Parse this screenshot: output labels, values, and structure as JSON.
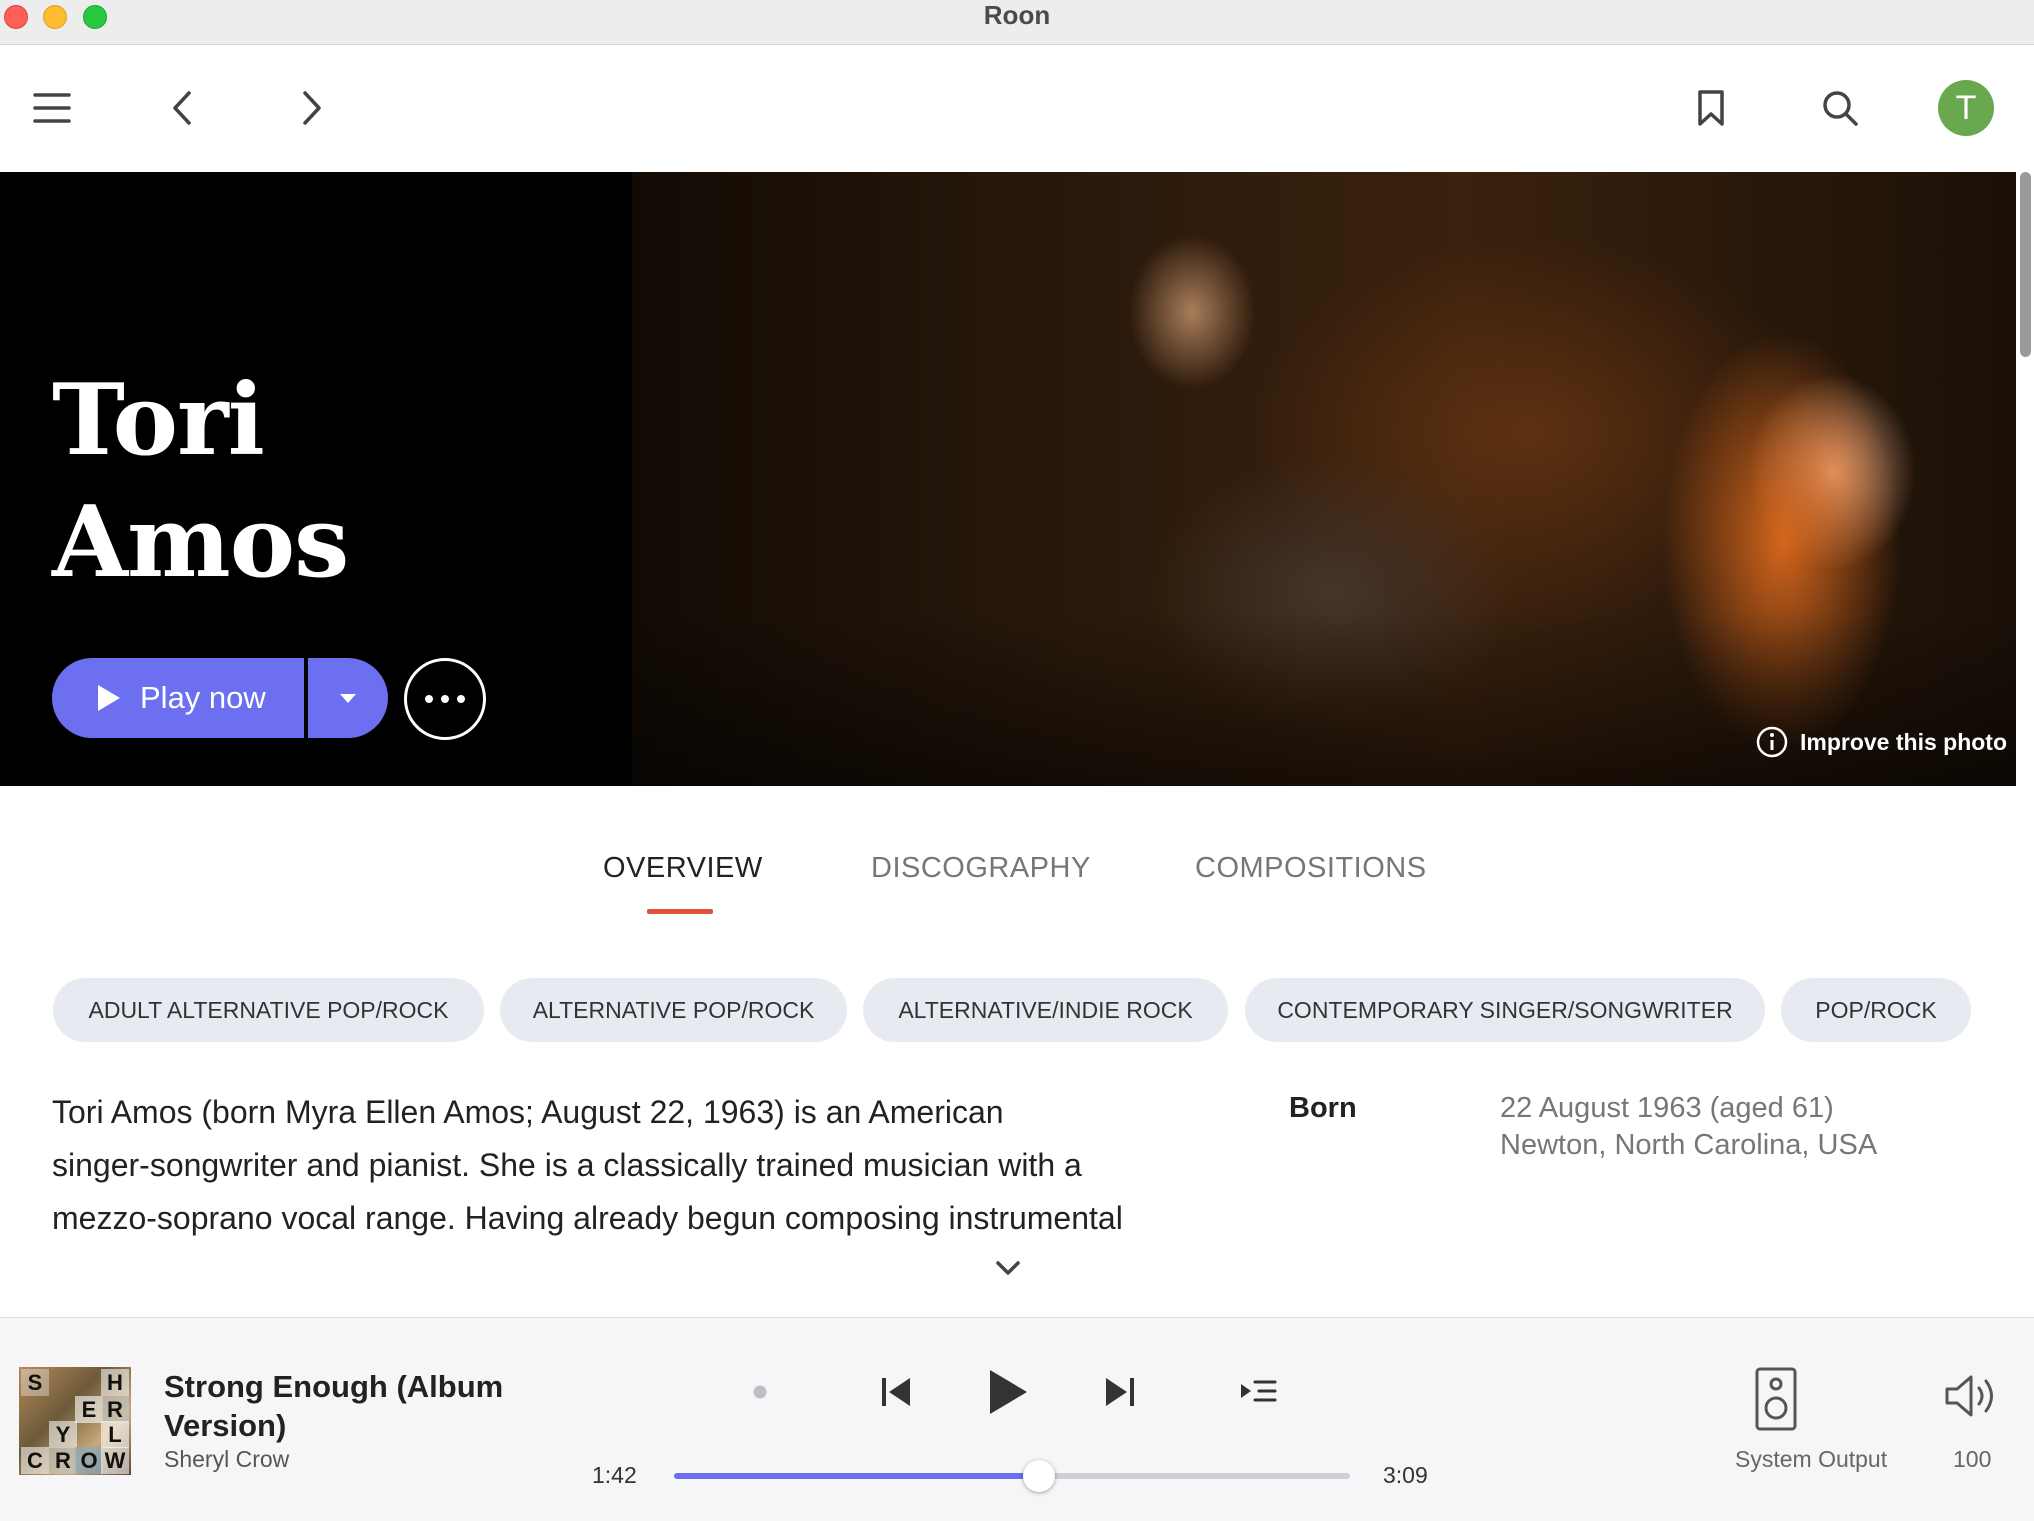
{
  "window": {
    "title": "Roon"
  },
  "toolbar": {
    "menu_icon": "hamburger-icon",
    "back_icon": "chevron-left-icon",
    "forward_icon": "chevron-right-icon",
    "bookmark_icon": "bookmark-icon",
    "search_icon": "search-icon",
    "avatar_letter": "T",
    "avatar_color": "#6aa84f"
  },
  "hero": {
    "artist_first": "Tori",
    "artist_last": "Amos",
    "play_label": "Play now",
    "improve_label": "Improve this photo",
    "accent": "#6c6ff0"
  },
  "tabs": [
    {
      "label": "OVERVIEW",
      "active": true
    },
    {
      "label": "DISCOGRAPHY",
      "active": false
    },
    {
      "label": "COMPOSITIONS",
      "active": false
    }
  ],
  "genres": [
    "ADULT ALTERNATIVE POP/ROCK",
    "ALTERNATIVE POP/ROCK",
    "ALTERNATIVE/INDIE ROCK",
    "CONTEMPORARY SINGER/SONGWRITER",
    "POP/ROCK"
  ],
  "bio": {
    "lines": [
      "Tori Amos (born Myra Ellen Amos; August 22, 1963) is an American",
      "singer-songwriter and pianist. She is a classically trained musician with a",
      "mezzo-soprano vocal range. Having already begun composing instrumental"
    ],
    "born_label": "Born",
    "born_date": "22 August 1963 (aged 61)",
    "born_place": "Newton, North Carolina, USA"
  },
  "player": {
    "track_title": "Strong Enough (Album Version)",
    "track_artist": "Sheryl Crow",
    "album_art_letters": [
      "S",
      "H",
      "E",
      "R",
      "Y",
      "L",
      "C",
      "R",
      "O",
      "W"
    ],
    "elapsed": "1:42",
    "duration": "3:09",
    "progress": 0.54,
    "output_label": "System Output",
    "volume": "100"
  }
}
